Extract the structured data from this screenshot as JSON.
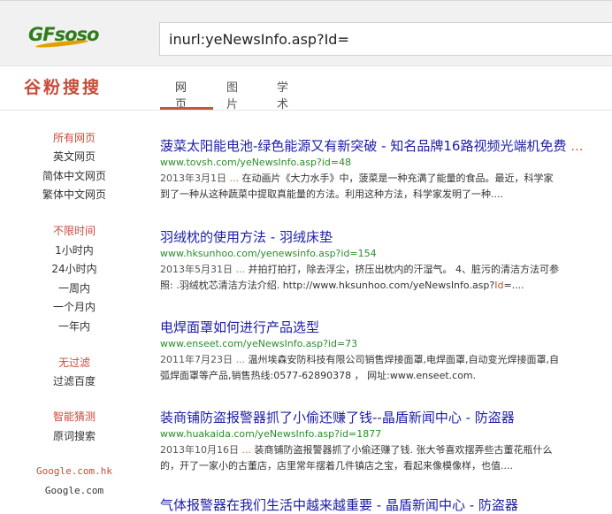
{
  "header": {
    "logo_text": "GFsoso",
    "search_value": "inurl:yeNewsInfo.asp?Id="
  },
  "brand": "谷粉搜搜",
  "tabs": [
    {
      "label": "网页",
      "active": true
    },
    {
      "label": "图片",
      "active": false
    },
    {
      "label": "学术",
      "active": false
    }
  ],
  "sidebar": {
    "group1": [
      "所有网页",
      "英文网页",
      "简体中文网页",
      "繁体中文网页"
    ],
    "group2": [
      "不限时间",
      "1小时内",
      "24小时内",
      "一周内",
      "一个月内",
      "一年内"
    ],
    "group3": [
      "无过滤",
      "过滤百度"
    ],
    "group4": [
      "智能猜测",
      "原词搜索"
    ],
    "group5": [
      "Google.com.hk",
      "Google.com"
    ]
  },
  "results": [
    {
      "title": "菠菜太阳能电池-绿色能源又有新突破 - 知名品牌16路视频光端机免费",
      "url": "www.tovsh.com/yeNewsInfo.asp?id=48",
      "date": "2013年3月1日",
      "snippet1": "在动画片《大力水手》中，菠菜是一种充满了能量的食品。最近，科学家",
      "snippet2": "到了一种从这种蔬菜中提取真能量的方法。利用这种方法，科学家发明了一种...."
    },
    {
      "title": "羽绒枕的使用方法 - 羽绒床垫",
      "url": "www.hksunhoo.com/yenewsinfo.asp?id=154",
      "date": "2013年5月31日",
      "snippet1": "并拍打拍打，除去浮尘，挤压出枕内的汗湿气。 4、脏污的清洁方法可参",
      "snippet2a": "照: .羽绒枕芯清洁方法介绍. http://www.hksunhoo.com/yeNewsInfo.asp?",
      "snippet2b": "Id",
      "snippet2c": "=...."
    },
    {
      "title": "电焊面罩如何进行产品选型",
      "url": "www.enseet.com/yeNewsInfo.asp?id=73",
      "date": "2011年7月23日",
      "snippet1": "温州埃森安防科技有限公司销售焊接面罩,电焊面罩,自动变光焊接面罩,自",
      "snippet2": "弧焊面罩等产品,销售热线:0577-62890378 ， 网址:www.enseet.com."
    },
    {
      "title": "装商铺防盗报警器抓了小偷还赚了钱--晶盾新闻中心 - 防盗器",
      "url": "www.huakaida.com/yeNewsInfo.asp?id=1877",
      "date": "2013年10月16日",
      "snippet1": "装商铺防盗报警器抓了小偷还赚了钱. 张大爷喜欢摆弄些古董花瓶什么",
      "snippet2": "的，开了一家小的古董店，店里常年摆着几件镇店之宝，看起来像模像样，也值...."
    },
    {
      "title": "气体报警器在我们生活中越来越重要 - 晶盾新闻中心 - 防盗器"
    }
  ],
  "ellipsis": "...",
  "colors": {
    "accent": "#c84a3a",
    "link": "#1d1da8",
    "url": "#2a8d2a"
  }
}
